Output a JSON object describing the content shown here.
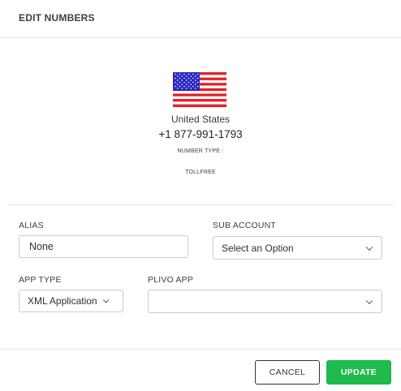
{
  "modal": {
    "title": "EDIT NUMBERS"
  },
  "number": {
    "flag_icon": "us-flag-icon",
    "country": "United States",
    "phone": "+1 877-991-1793",
    "type_label": "NUMBER TYPE :",
    "type_value": "TOLLFREE"
  },
  "form": {
    "alias_label": "ALIAS",
    "alias_value": "None",
    "sub_account_label": "SUB ACCOUNT",
    "sub_account_value": "Select an Option",
    "app_type_label": "APP TYPE",
    "app_type_value": "XML Application",
    "plivo_app_label": "PLIVO APP",
    "plivo_app_value": ""
  },
  "footer": {
    "cancel_label": "CANCEL",
    "update_label": "UPDATE"
  },
  "colors": {
    "primary_button": "#1ebb4c",
    "flag_blue": "#2a27c4",
    "flag_red": "#e61f28"
  }
}
